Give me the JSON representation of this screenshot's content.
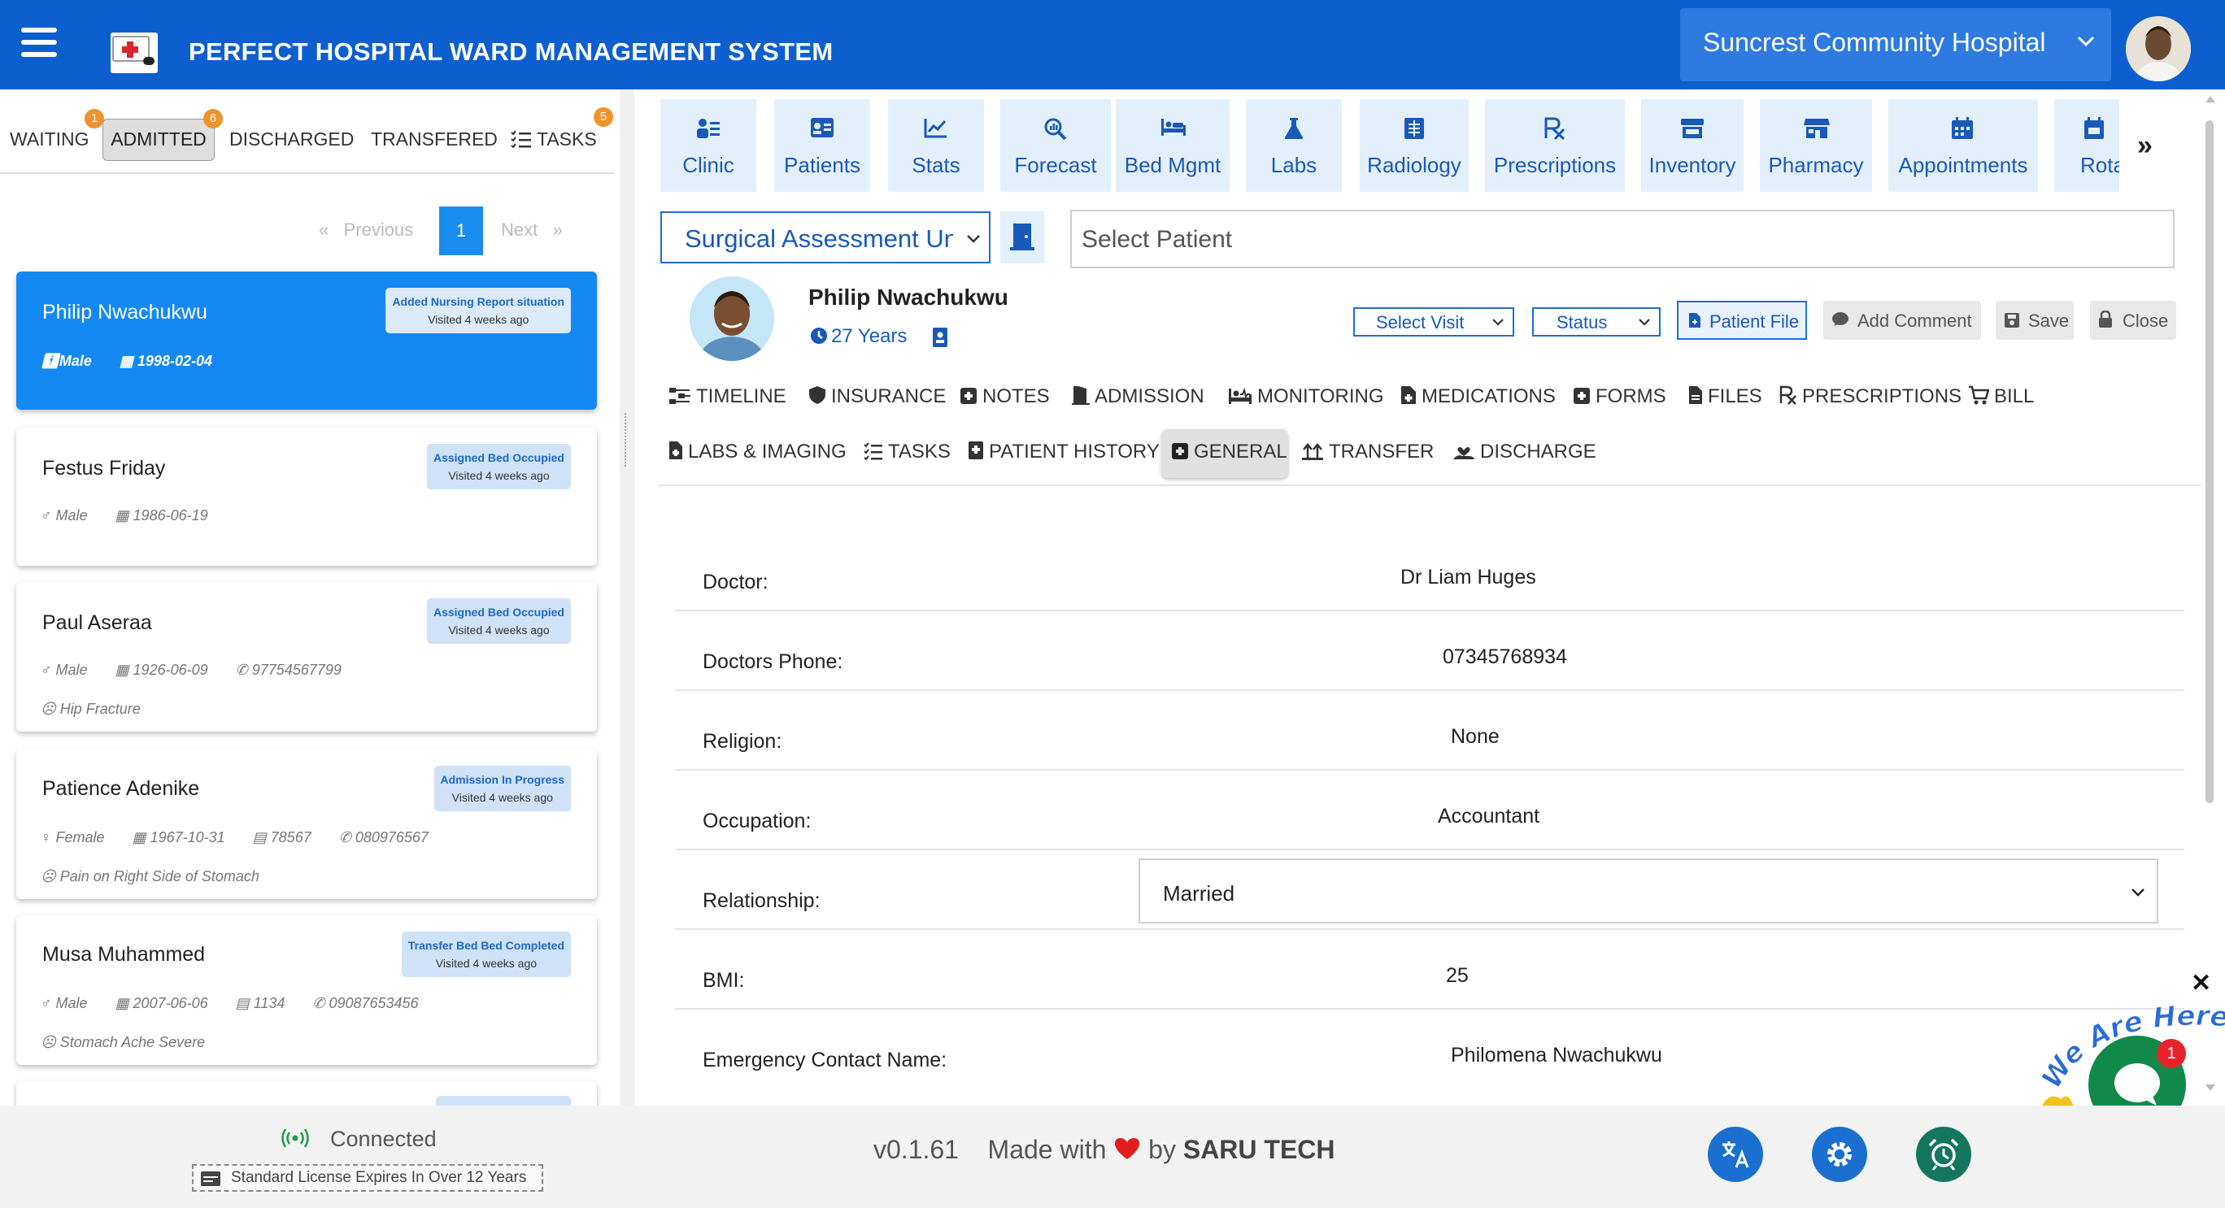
{
  "header": {
    "title": "PERFECT HOSPITAL WARD MANAGEMENT SYSTEM",
    "hospital": "Suncrest Community Hospital",
    "brand_color": "#0d5fd0"
  },
  "left_tabs": {
    "waiting": "WAITING",
    "waiting_count": "1",
    "admitted": "ADMITTED",
    "admitted_count": "6",
    "discharged": "DISCHARGED",
    "transfered": "TRANSFERED",
    "tasks": "TASKS",
    "tasks_count": "5"
  },
  "pagination": {
    "previous": "Previous",
    "current": "1",
    "next": "Next"
  },
  "patients": [
    {
      "name": "Philip Nwachukwu",
      "status": "Added Nursing Report situation",
      "visited": "Visited 4 weeks ago",
      "gender": "Male",
      "dob": "1998-02-04"
    },
    {
      "name": "Festus Friday",
      "status": "Assigned Bed Occupied",
      "visited": "Visited 4 weeks ago",
      "gender": "Male",
      "dob": "1986-06-19"
    },
    {
      "name": "Paul Aseraa",
      "status": "Assigned Bed Occupied",
      "visited": "Visited 4 weeks ago",
      "gender": "Male",
      "dob": "1926-06-09",
      "phone": "97754567799",
      "complaint": "Hip Fracture"
    },
    {
      "name": "Patience Adenike",
      "status": "Admission In Progress",
      "visited": "Visited 4 weeks ago",
      "gender": "Female",
      "dob": "1967-10-31",
      "id": "78567",
      "phone": "080976567",
      "complaint": "Pain on Right Side of Stomach"
    },
    {
      "name": "Musa Muhammed",
      "status": "Transfer Bed Bed Completed",
      "visited": "Visited 4 weeks ago",
      "gender": "Male",
      "dob": "2007-06-06",
      "id": "1134",
      "phone": "09087653456",
      "complaint": "Stomach Ache Severe"
    }
  ],
  "modules": [
    "Clinic",
    "Patients",
    "Stats",
    "Forecast",
    "Bed Mgmt",
    "Labs",
    "Radiology",
    "Prescriptions",
    "Inventory",
    "Pharmacy",
    "Appointments",
    "Rota"
  ],
  "ward": {
    "selected": "Surgical Assessment Unit"
  },
  "patient_search": {
    "placeholder": "Select  Patient"
  },
  "patient": {
    "name": "Philip Nwachukwu",
    "age": "27 Years"
  },
  "actions": {
    "select_visit": "Select Visit",
    "status": "Status",
    "patient_file": "Patient File",
    "add_comment": "Add Comment",
    "save": "Save",
    "close": "Close"
  },
  "section_tabs": [
    "TIMELINE",
    "INSURANCE",
    "NOTES",
    "ADMISSION",
    "MONITORING",
    "MEDICATIONS",
    "FORMS",
    "FILES",
    "PRESCRIPTIONS",
    "BILL",
    "LABS & IMAGING",
    "TASKS",
    "PATIENT HISTORY",
    "GENERAL",
    "TRANSFER",
    "DISCHARGE"
  ],
  "general": {
    "doctor_label": "Doctor:",
    "doctor": "Dr Liam Huges",
    "phone_label": "Doctors Phone:",
    "phone": "07345768934",
    "religion_label": "Religion:",
    "religion": "None",
    "occupation_label": "Occupation:",
    "occupation": "Accountant",
    "relationship_label": "Relationship:",
    "relationship": "Married",
    "bmi_label": "BMI:",
    "bmi": "25",
    "emergency_label": "Emergency Contact Name:",
    "emergency": "Philomena Nwachukwu"
  },
  "chat": {
    "wave_text": "We Are Here!",
    "unread": "1"
  },
  "footer": {
    "connection": "Connected",
    "license": "Standard License Expires In Over 12 Years",
    "version": "v0.1.61",
    "made_with": "Made with",
    "by": "by",
    "company": "SARU TECH"
  }
}
